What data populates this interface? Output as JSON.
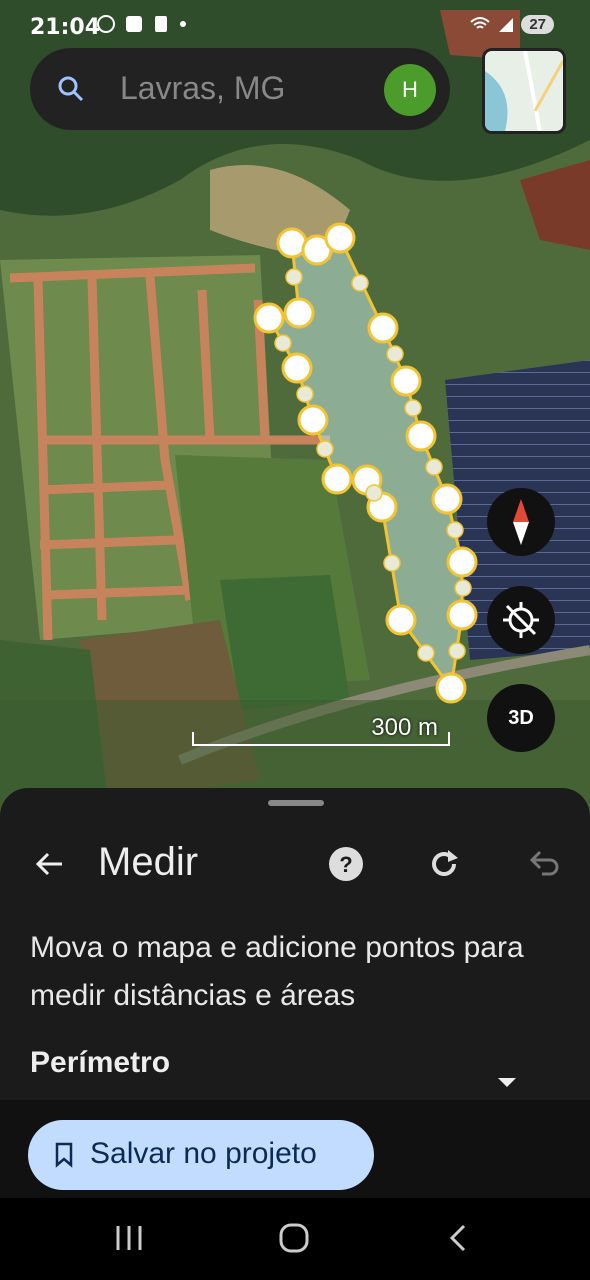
{
  "status": {
    "time": "21:04",
    "battery": "27"
  },
  "search": {
    "placeholder": "Lavras, MG",
    "avatar_initial": "H"
  },
  "map": {
    "scale_label": "300 m",
    "button_3d": "3D"
  },
  "measure": {
    "title": "Medir",
    "instructions": "Mova o mapa e adicione pontos para medir distâncias e áreas",
    "perimeter_label": "Perímetro"
  },
  "footer": {
    "save_label": "Salvar no projeto"
  },
  "colors": {
    "accent_pin": "#f2c433",
    "save_bg": "#c2dcff",
    "sheet_bg": "#1b1b1b"
  }
}
